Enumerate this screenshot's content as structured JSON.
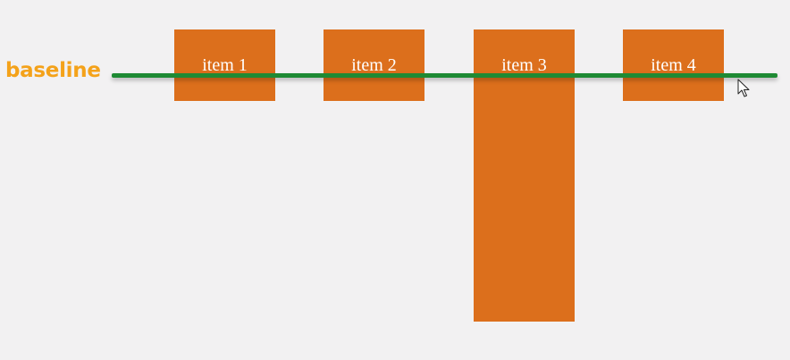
{
  "baseline": {
    "label": "baseline",
    "label_color": "#f4a21a",
    "line_color": "#1e8a33"
  },
  "items": [
    {
      "label": "item 1"
    },
    {
      "label": "item 2"
    },
    {
      "label": "item 3"
    },
    {
      "label": "item 4"
    }
  ],
  "colors": {
    "item_fill": "#dc6f1c",
    "background": "#f2f1f2"
  },
  "cursor": {
    "icon": "mouse-pointer-icon"
  }
}
